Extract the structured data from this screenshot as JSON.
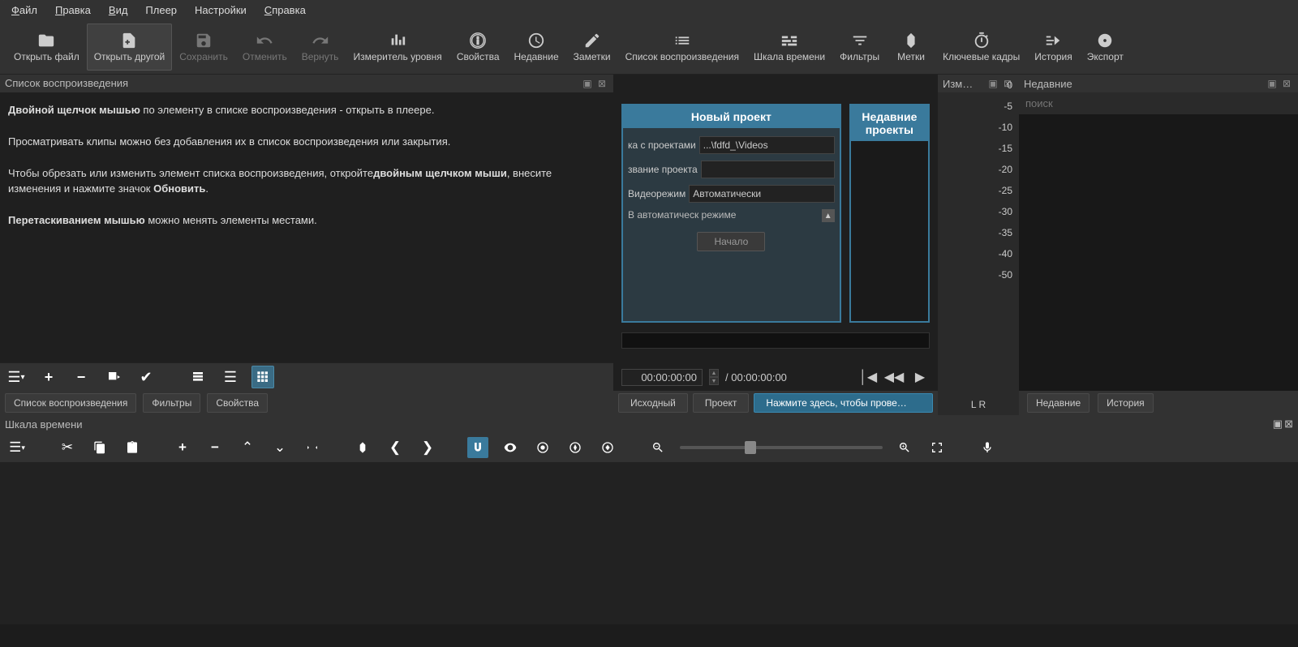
{
  "menu": {
    "file": "Файл",
    "edit": "Правка",
    "view": "Вид",
    "player": "Плеер",
    "settings": "Настройки",
    "help": "Справка"
  },
  "toolbar": {
    "open_file": "Открыть файл",
    "open_other": "Открыть другой",
    "save": "Сохранить",
    "undo": "Отменить",
    "redo": "Вернуть",
    "level_meter": "Измеритель уровня",
    "properties": "Свойства",
    "recent": "Недавние",
    "notes": "Заметки",
    "playlist": "Список воспроизведения",
    "timeline": "Шкала времени",
    "filters": "Фильтры",
    "markers": "Метки",
    "keyframes": "Ключевые кадры",
    "history": "История",
    "export": "Экспорт"
  },
  "playlist_panel": {
    "title": "Список воспроизведения",
    "help_bold1": "Двойной щелчок мышью",
    "help_text1": " по элементу в списке воспроизведения - открыть в плеере.",
    "help_text2": "Просматривать клипы можно без добавления их в список воспроизведения или закрытия.",
    "help_text3a": "Чтобы обрезать или изменить элемент списка воспроизведения, откройте",
    "help_bold3": "двойным щелчком мыши",
    "help_text3b": ", внесите изменения и нажмите значок ",
    "help_bold3b": "Обновить",
    "help_bold4": "Перетаскиванием мышью",
    "help_text4": " можно менять элементы местами.",
    "tabs": {
      "playlist": "Список воспроизведения",
      "filters": "Фильтры",
      "properties": "Свойства"
    }
  },
  "meter_panel": {
    "title": "Изм…",
    "scale": [
      "0",
      "-5",
      "-10",
      "-15",
      "-20",
      "-25",
      "-30",
      "-35",
      "-40",
      "-50"
    ],
    "lr": "L   R"
  },
  "recent_panel": {
    "title": "Недавние",
    "search_ph": "поиск",
    "tab_recent": "Недавние",
    "tab_history": "История"
  },
  "viewer": {
    "new_project": "Новый проект",
    "recent_projects": "Недавние проекты",
    "folder_label": "ка с проектами",
    "folder_value": "...\\fdfd_\\Videos",
    "name_label": "звание проекта",
    "mode_label": "Видеорежим",
    "mode_value": "Автоматически",
    "desc": "В автоматическ режиме",
    "start": "Начало",
    "tc_current": "00:00:00:00",
    "tc_sep": " / ",
    "tc_total": "00:00:00:00",
    "tab_source": "Исходный",
    "tab_project": "Проект",
    "tab_click": "Нажмите здесь, чтобы прове…"
  },
  "timeline": {
    "title": "Шкала времени"
  }
}
